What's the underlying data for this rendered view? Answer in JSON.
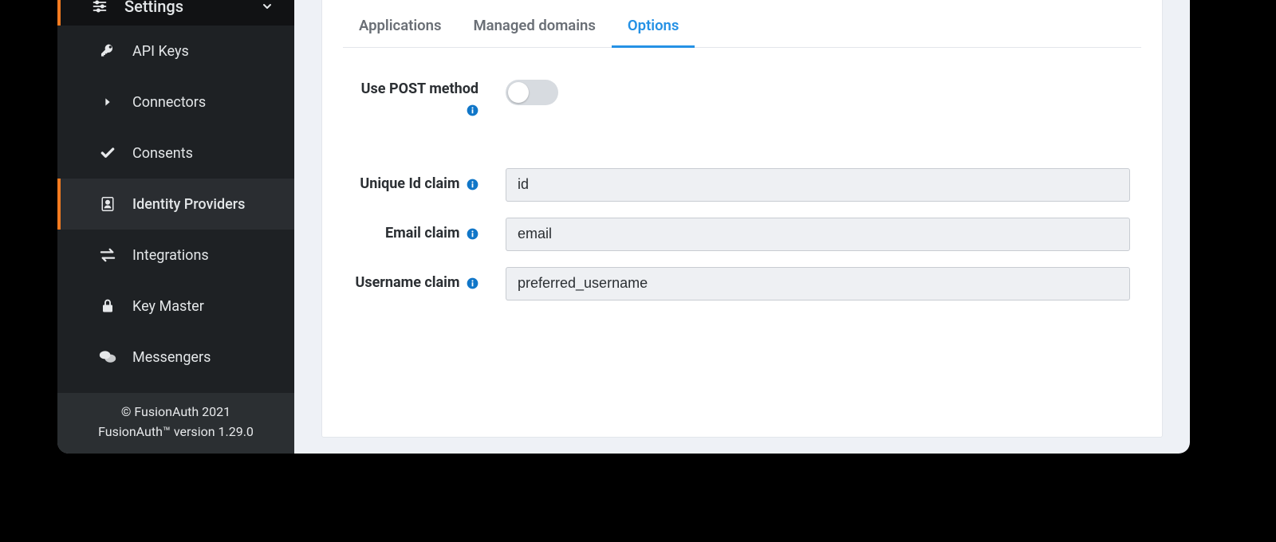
{
  "sidebar": {
    "header": {
      "label": "Settings"
    },
    "items": [
      {
        "label": "API Keys"
      },
      {
        "label": "Connectors"
      },
      {
        "label": "Consents"
      },
      {
        "label": "Identity Providers"
      },
      {
        "label": "Integrations"
      },
      {
        "label": "Key Master"
      },
      {
        "label": "Messengers"
      }
    ],
    "footer": {
      "line1": "© FusionAuth 2021",
      "line2": "FusionAuth™ version 1.29.0"
    }
  },
  "tabs": {
    "items": [
      {
        "label": "Applications"
      },
      {
        "label": "Managed domains"
      },
      {
        "label": "Options"
      }
    ],
    "active_index": 2
  },
  "form": {
    "use_post": {
      "label": "Use POST method",
      "value": false
    },
    "unique_id": {
      "label": "Unique Id claim",
      "value": "id"
    },
    "email": {
      "label": "Email claim",
      "value": "email"
    },
    "username": {
      "label": "Username claim",
      "value": "preferred_username"
    }
  }
}
